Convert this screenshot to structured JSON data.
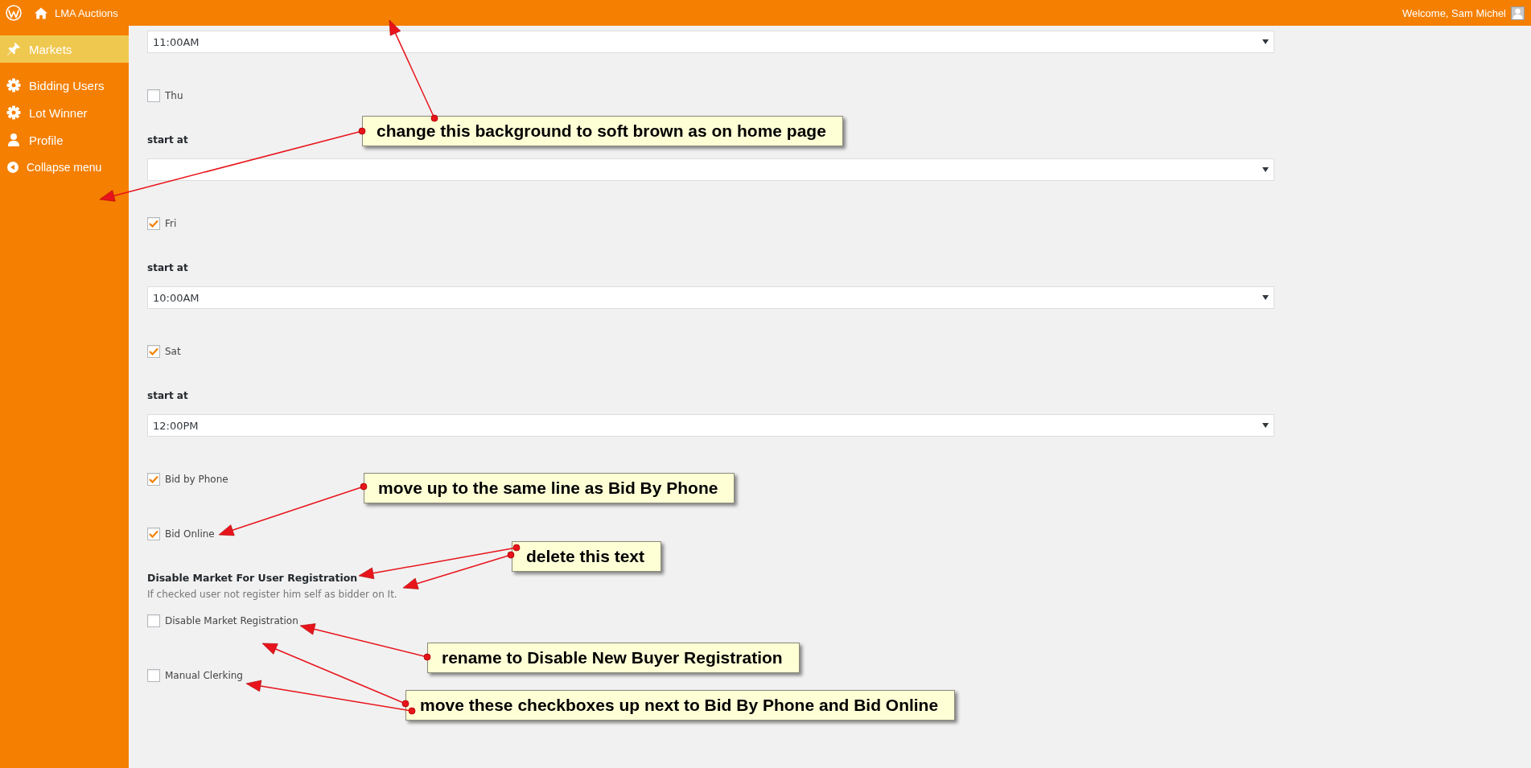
{
  "admin_bar": {
    "site_name": "LMA Auctions",
    "welcome": "Welcome, Sam Michel"
  },
  "sidebar": {
    "items": [
      {
        "label": "Markets",
        "selected": true
      },
      {
        "label": "Bidding Users",
        "selected": false
      },
      {
        "label": "Lot Winner",
        "selected": false
      },
      {
        "label": "Profile",
        "selected": false
      }
    ],
    "collapse": "Collapse menu"
  },
  "form": {
    "fields": [
      {
        "kind": "select",
        "value": "11:00AM"
      },
      {
        "kind": "checkbox",
        "label": "Thu",
        "checked": false
      },
      {
        "kind": "label",
        "text": "start at"
      },
      {
        "kind": "select"
      },
      {
        "kind": "checkbox",
        "label": "Fri",
        "checked": true
      },
      {
        "kind": "label",
        "text": "start at"
      },
      {
        "kind": "select",
        "value": "10:00AM"
      },
      {
        "kind": "checkbox",
        "label": "Sat",
        "checked": true
      },
      {
        "kind": "label",
        "text": "start at"
      },
      {
        "kind": "select",
        "value": "12:00PM"
      },
      {
        "kind": "checkbox",
        "label": "Bid by Phone",
        "checked": true
      },
      {
        "kind": "checkbox",
        "label": "Bid Online",
        "checked": true
      },
      {
        "kind": "section",
        "title": "Disable Market For User Registration",
        "description": "If checked user not register him self as bidder on It."
      },
      {
        "kind": "checkbox",
        "label": "Disable Market Registration",
        "checked": false
      },
      {
        "kind": "checkbox",
        "label": "Manual Clerking",
        "checked": false
      }
    ]
  },
  "annotations": [
    {
      "text": "change this background to soft brown as on home page"
    },
    {
      "text": "move up to the same line as Bid By Phone"
    },
    {
      "text": "delete this text"
    },
    {
      "text": "rename to Disable New Buyer Registration"
    },
    {
      "text": "move these checkboxes up next to Bid By Phone and Bid Online"
    }
  ]
}
